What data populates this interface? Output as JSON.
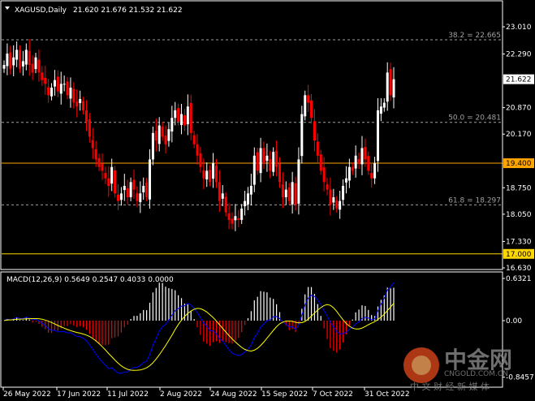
{
  "header": {
    "symbol": "XAGUSD,Daily",
    "ohlc": "21.620 21.676 21.532 21.622"
  },
  "macd_header": "MACD(12,26,9) 0.5649 0.2547 0.4033 0.0000",
  "colors": {
    "background": "#000000",
    "bull": "#ffffff",
    "bear": "#ff0000",
    "macd": "#0000ff",
    "signal": "#ffff00",
    "level_orange": "#ffa500",
    "level_yellow": "#ffd700",
    "fib": "#a0a0a0"
  },
  "watermark": {
    "logo": "中金网",
    "site": "CNGOLD.COM.CN",
    "slogan": "中 文 财 经 新 媒 体"
  },
  "chart_data": [
    {
      "type": "candlestick",
      "title": "XAGUSD,Daily",
      "ylim": [
        16.63,
        23.01
      ],
      "yticks": [
        "23.010",
        "22.290",
        "20.870",
        "20.170",
        "18.750",
        "18.050",
        "17.330",
        "16.630"
      ],
      "current_price": "21.622",
      "xticks": [
        "26 May 2022",
        "17 Jun 2022",
        "11 Jul 2022",
        "2 Aug 2022",
        "24 Aug 2022",
        "15 Sep 2022",
        "7 Oct 2022",
        "31 Oct 2022"
      ],
      "fib_levels": [
        {
          "label": "38.2 = 22.665",
          "value": 22.665
        },
        {
          "label": "50.0 = 20.481",
          "value": 20.481
        },
        {
          "label": "61.8 = 18.297",
          "value": 18.297
        }
      ],
      "horizontal_levels": [
        {
          "label": "19.400",
          "value": 19.4,
          "color": "#ffa500"
        },
        {
          "label": "17.000",
          "value": 17.0,
          "color": "#ffd700"
        }
      ],
      "closes": [
        22.0,
        22.3,
        21.9,
        22.2,
        22.4,
        21.9,
        22.1,
        22.4,
        22.0,
        21.8,
        22.2,
        21.8,
        21.6,
        21.5,
        21.2,
        21.4,
        21.6,
        21.3,
        21.5,
        21.5,
        21.2,
        21.4,
        21.0,
        20.9,
        21.1,
        20.8,
        20.5,
        20.1,
        19.8,
        19.5,
        19.3,
        19.2,
        19.0,
        18.8,
        19.3,
        18.6,
        18.4,
        18.6,
        18.8,
        18.5,
        18.9,
        18.7,
        18.4,
        18.6,
        18.8,
        18.5,
        19.5,
        20.2,
        20.0,
        20.4,
        20.1,
        19.9,
        20.3,
        20.6,
        20.8,
        20.5,
        20.7,
        20.4,
        20.9,
        20.2,
        19.9,
        19.6,
        19.3,
        19.0,
        19.2,
        18.9,
        19.4,
        18.9,
        18.4,
        18.6,
        18.1,
        17.9,
        17.8,
        18.0,
        17.9,
        18.2,
        18.4,
        18.6,
        18.8,
        19.6,
        19.2,
        19.8,
        19.4,
        19.6,
        19.2,
        19.7,
        19.3,
        18.9,
        18.5,
        18.7,
        18.4,
        18.9,
        18.3,
        19.5,
        20.7,
        21.2,
        21.0,
        20.6,
        20.0,
        19.6,
        19.2,
        18.9,
        18.7,
        18.3,
        18.5,
        18.2,
        18.4,
        18.8,
        19.0,
        19.3,
        19.2,
        19.6,
        19.4,
        19.8,
        19.5,
        19.2,
        19.0,
        19.4,
        20.8,
        20.9,
        21.0,
        21.8,
        21.2,
        21.622
      ]
    },
    {
      "type": "macd",
      "title": "MACD(12,26,9)",
      "ylim": [
        -0.8457,
        0.6321
      ],
      "yticks": [
        "0.6321",
        "0.00",
        "-0.8457"
      ]
    }
  ]
}
